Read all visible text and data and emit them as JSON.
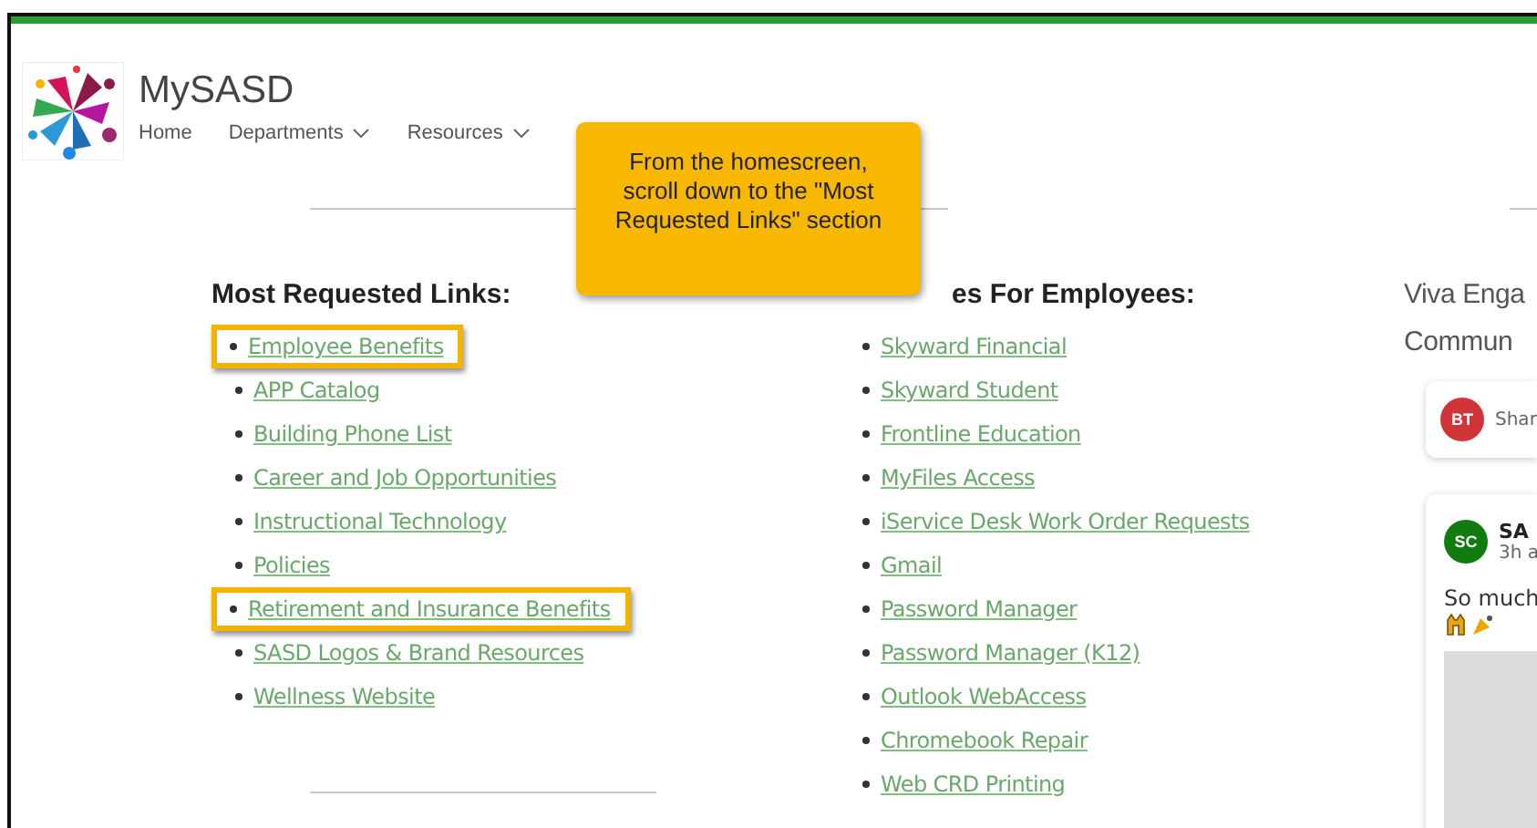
{
  "site": {
    "title": "MySASD",
    "nav": [
      {
        "label": "Home",
        "dropdown": false
      },
      {
        "label": "Departments",
        "dropdown": true
      },
      {
        "label": "Resources",
        "dropdown": true
      }
    ]
  },
  "callout": {
    "text": "From the homescreen, scroll down to the \"Most Requested Links\" section"
  },
  "most_requested": {
    "heading": "Most Requested Links:",
    "links": [
      {
        "label": "Employee Benefits",
        "highlighted": true
      },
      {
        "label": "APP Catalog",
        "highlighted": false
      },
      {
        "label": "Building Phone List",
        "highlighted": false
      },
      {
        "label": "Career and Job Opportunities",
        "highlighted": false
      },
      {
        "label": "Instructional Technology",
        "highlighted": false
      },
      {
        "label": "Policies",
        "highlighted": false
      },
      {
        "label": "Retirement and Insurance Benefits",
        "highlighted": true
      },
      {
        "label": "SASD Logos & Brand Resources",
        "highlighted": false
      },
      {
        "label": "Wellness Website",
        "highlighted": false
      }
    ]
  },
  "resources": {
    "heading": "es For Employees:",
    "links": [
      {
        "label": "Skyward Financial"
      },
      {
        "label": "Skyward Student"
      },
      {
        "label": "Frontline Education"
      },
      {
        "label": "MyFiles Access"
      },
      {
        "label": "iService Desk Work Order Requests"
      },
      {
        "label": "Gmail"
      },
      {
        "label": "Password Manager"
      },
      {
        "label": "Password Manager (K12)"
      },
      {
        "label": "Outlook WebAccess"
      },
      {
        "label": "Chromebook Repair"
      },
      {
        "label": "Web CRD Printing"
      }
    ]
  },
  "viva_panel": {
    "title_lines": [
      "Viva Enga",
      "Commun"
    ],
    "share_card": {
      "avatar": "BT",
      "color": "#d13438",
      "text": "Shar"
    },
    "post": {
      "avatar": "SC",
      "color": "#107c10",
      "author": "SA",
      "time": "3h a",
      "text": "So much"
    }
  }
}
